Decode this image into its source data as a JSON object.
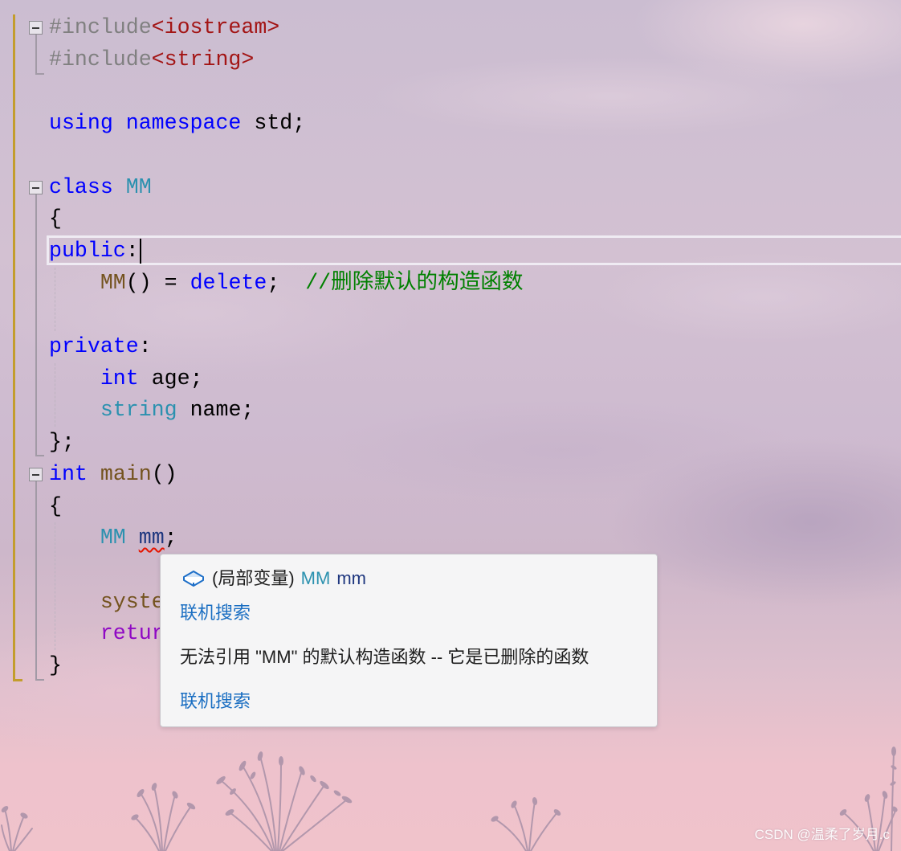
{
  "editor": {
    "lines": [
      {
        "tokens": [
          {
            "text": "#include",
            "color": "#808080"
          },
          {
            "text": "<iostream>",
            "color": "#a31515"
          }
        ]
      },
      {
        "tokens": [
          {
            "text": "#include",
            "color": "#808080"
          },
          {
            "text": "<string>",
            "color": "#a31515"
          }
        ]
      },
      {
        "tokens": []
      },
      {
        "tokens": [
          {
            "text": "using",
            "color": "#0000ff"
          },
          {
            "text": " ",
            "color": "#000000"
          },
          {
            "text": "namespace",
            "color": "#0000ff"
          },
          {
            "text": " std;",
            "color": "#000000"
          }
        ]
      },
      {
        "tokens": []
      },
      {
        "tokens": [
          {
            "text": "class",
            "color": "#0000ff"
          },
          {
            "text": " ",
            "color": "#000000"
          },
          {
            "text": "MM",
            "color": "#2b91af"
          }
        ]
      },
      {
        "tokens": [
          {
            "text": "{",
            "color": "#000000"
          }
        ]
      },
      {
        "tokens": [
          {
            "text": "public",
            "color": "#0000ff"
          },
          {
            "text": ":",
            "color": "#000000"
          }
        ]
      },
      {
        "tokens": [
          {
            "text": "    ",
            "color": "#000000"
          },
          {
            "text": "MM",
            "color": "#74531f"
          },
          {
            "text": "() = ",
            "color": "#000000"
          },
          {
            "text": "delete",
            "color": "#0000ff"
          },
          {
            "text": ";  ",
            "color": "#000000"
          },
          {
            "text": "//删除默认的构造函数",
            "color": "#008000"
          }
        ]
      },
      {
        "tokens": []
      },
      {
        "tokens": [
          {
            "text": "private",
            "color": "#0000ff"
          },
          {
            "text": ":",
            "color": "#000000"
          }
        ]
      },
      {
        "tokens": [
          {
            "text": "    ",
            "color": "#000000"
          },
          {
            "text": "int",
            "color": "#0000ff"
          },
          {
            "text": " age;",
            "color": "#000000"
          }
        ]
      },
      {
        "tokens": [
          {
            "text": "    ",
            "color": "#000000"
          },
          {
            "text": "string",
            "color": "#2b91af"
          },
          {
            "text": " name;",
            "color": "#000000"
          }
        ]
      },
      {
        "tokens": [
          {
            "text": "};",
            "color": "#000000"
          }
        ]
      },
      {
        "tokens": [
          {
            "text": "int",
            "color": "#0000ff"
          },
          {
            "text": " ",
            "color": "#000000"
          },
          {
            "text": "main",
            "color": "#74531f"
          },
          {
            "text": "()",
            "color": "#000000"
          }
        ]
      },
      {
        "tokens": [
          {
            "text": "{",
            "color": "#000000"
          }
        ]
      },
      {
        "tokens": [
          {
            "text": "    ",
            "color": "#000000"
          },
          {
            "text": "MM",
            "color": "#2b91af"
          },
          {
            "text": " ",
            "color": "#000000"
          },
          {
            "text": "mm",
            "color": "#1f377f",
            "error_squiggle": true
          },
          {
            "text": ";",
            "color": "#000000"
          }
        ]
      },
      {
        "tokens": []
      },
      {
        "tokens": [
          {
            "text": "    ",
            "color": "#000000"
          },
          {
            "text": "syste",
            "color": "#74531f"
          }
        ]
      },
      {
        "tokens": [
          {
            "text": "    ",
            "color": "#000000"
          },
          {
            "text": "retur",
            "color": "#8f08c4"
          }
        ]
      },
      {
        "tokens": [
          {
            "text": "}",
            "color": "#000000"
          }
        ]
      }
    ]
  },
  "quick_info": {
    "icon": "local-variable-icon",
    "kind_label": "(局部变量)",
    "type_name": "MM",
    "var_name": "mm",
    "search_link_1": "联机搜索",
    "error_message": "无法引用 \"MM\" 的默认构造函数 -- 它是已删除的函数",
    "search_link_2": "联机搜索"
  },
  "watermark": "CSDN @温柔了岁月.c",
  "colors": {
    "change_bar": "#c39d2d",
    "error_squiggle": "#e51400",
    "link": "#1a6ec2",
    "type_name": "#2b91af",
    "var_name": "#1f377f",
    "text": "#1e1e1e"
  }
}
